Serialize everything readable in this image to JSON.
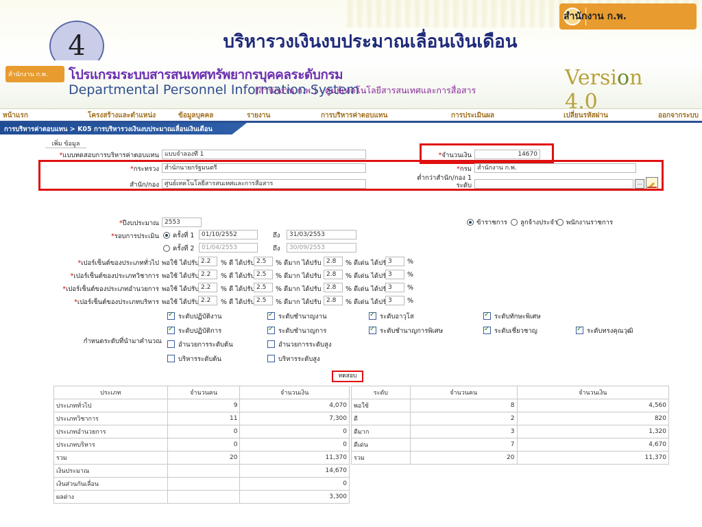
{
  "slide": {
    "number": "4",
    "title": "บริหารวงเงินงบประมาณเลื่อนเงินเดือน",
    "logo_text": "สำนักงาน ก.พ."
  },
  "app": {
    "logo_small": "สำนักงาน ก.พ.",
    "name_th": "โปรแกรมระบบสารสนเทศทรัพยากรบุคคลระดับกรม",
    "name_en": "Departmental Personnel Information System",
    "org": "[สำนักงาน ก.พ.] - ศูนย์เทคโนโลยีสารสนเทศและการสื่อสาร",
    "version_prefix": "Versi",
    "version_suffix": "n 4.0"
  },
  "nav": [
    "หน้าแรก",
    "โครงสร้างและตำแหน่ง",
    "ข้อมูลบุคคล",
    "รายงาน",
    "การบริหารค่าตอบแทน",
    "การประเมินผล",
    "เปลี่ยนรหัสผ่าน",
    "ออกจากระบบ"
  ],
  "breadcrumb": "การบริหารค่าตอบแทน > K05 การบริหารวงเงินงบประมาณเลื่อนเงินเดือน",
  "form": {
    "add_tab": "เพิ่ม ข้อมูล",
    "template_label": "แบบทดสอบการบริหารค่าตอบแทน",
    "template_value": "แบบจำลองที่ 1",
    "amount_label": "จำนวนเงิน",
    "amount_value": "14670",
    "ministry_label": "กระทรวง",
    "ministry_value": "สำนักนายกรัฐมนตรี",
    "dept_label": "กรม",
    "dept_value": "สำนักงาน ก.พ.",
    "office_label": "สำนัก/กอง",
    "office_value": "ศูนย์เทคโนโลยีสารสนเทศและการสื่อสาร",
    "suboffice_label_1": "ต่ำกว่าสำนัก/กอง 1",
    "suboffice_label_2": "ระดับ",
    "suboffice_value": "",
    "year_label": "ปีงบประมาณ",
    "year_value": "2553",
    "staff_types": [
      "ข้าราชการ",
      "ลูกจ้างประจำ",
      "พนักงานราชการ"
    ],
    "round_label": "รอบการประเมิน",
    "round1_label": "ครั้งที่ 1",
    "round1_from": "01/10/2552",
    "round1_to": "31/03/2553",
    "round2_label": "ครั้งที่ 2",
    "round2_from": "01/04/2553",
    "round2_to": "30/09/2553",
    "to_label": "ถึง",
    "pct_rows": [
      {
        "label": "เปอร์เซ็นต์ของประเภททั่วไป"
      },
      {
        "label": "เปอร์เซ็นต์ของประเภทวิชาการ"
      },
      {
        "label": "เปอร์เซ็นต์ของประเภทอำนวยการ"
      },
      {
        "label": "เปอร์เซ็นต์ของประเภทบริหาร"
      }
    ],
    "pct_fair": "พอใช้ ได้ปรับ",
    "pct_good": "% ดี ได้ปรับ",
    "pct_vgood": "% ดีมาก ได้ปรับ",
    "pct_excellent": "% ดีเด่น ได้ปรับ",
    "pct_end": "%",
    "pct_values": [
      "2.2",
      "2.5",
      "2.8",
      "3"
    ],
    "levels_label": "กำหนดระดับที่นำมาคำนวณ",
    "levels": [
      [
        "ระดับปฏิบัติงาน",
        "ระดับชำนาญงาน",
        "ระดับอาวุโส",
        "ระดับทักษะพิเศษ"
      ],
      [
        "ระดับปฏิบัติการ",
        "ระดับชำนาญการ",
        "ระดับชำนาญการพิเศษ",
        "ระดับเชี่ยวชาญ",
        "ระดับทรงคุณวุฒิ"
      ],
      [
        "อำนวยการระดับต้น",
        "อำนวยการระดับสูง"
      ],
      [
        "บริหารระดับต้น",
        "บริหารระดับสูง"
      ]
    ],
    "test_button": "ทดสอบ"
  },
  "table_left": {
    "headers": [
      "ประเภท",
      "จำนวนคน",
      "จำนวนเงิน"
    ],
    "rows": [
      [
        "ประเภททั่วไป",
        "9",
        "4,070"
      ],
      [
        "ประเภทวิชาการ",
        "11",
        "7,300"
      ],
      [
        "ประเภทอำนวยการ",
        "0",
        "0"
      ],
      [
        "ประเภทบริหาร",
        "0",
        "0"
      ],
      [
        "รวม",
        "20",
        "11,370"
      ],
      [
        "เงินประมาณ",
        "",
        "14,670"
      ],
      [
        "เงินส่วนกันเลื่อน",
        "",
        "0"
      ],
      [
        "ผลต่าง",
        "",
        "3,300"
      ]
    ]
  },
  "table_right": {
    "headers": [
      "ระดับ",
      "จำนวนคน",
      "จำนวนเงิน"
    ],
    "rows": [
      [
        "พอใช้",
        "8",
        "4,560"
      ],
      [
        "ดี",
        "2",
        "820"
      ],
      [
        "ดีมาก",
        "3",
        "1,320"
      ],
      [
        "ดีเด่น",
        "7",
        "4,670"
      ],
      [
        "รวม",
        "20",
        "11,370"
      ]
    ]
  }
}
